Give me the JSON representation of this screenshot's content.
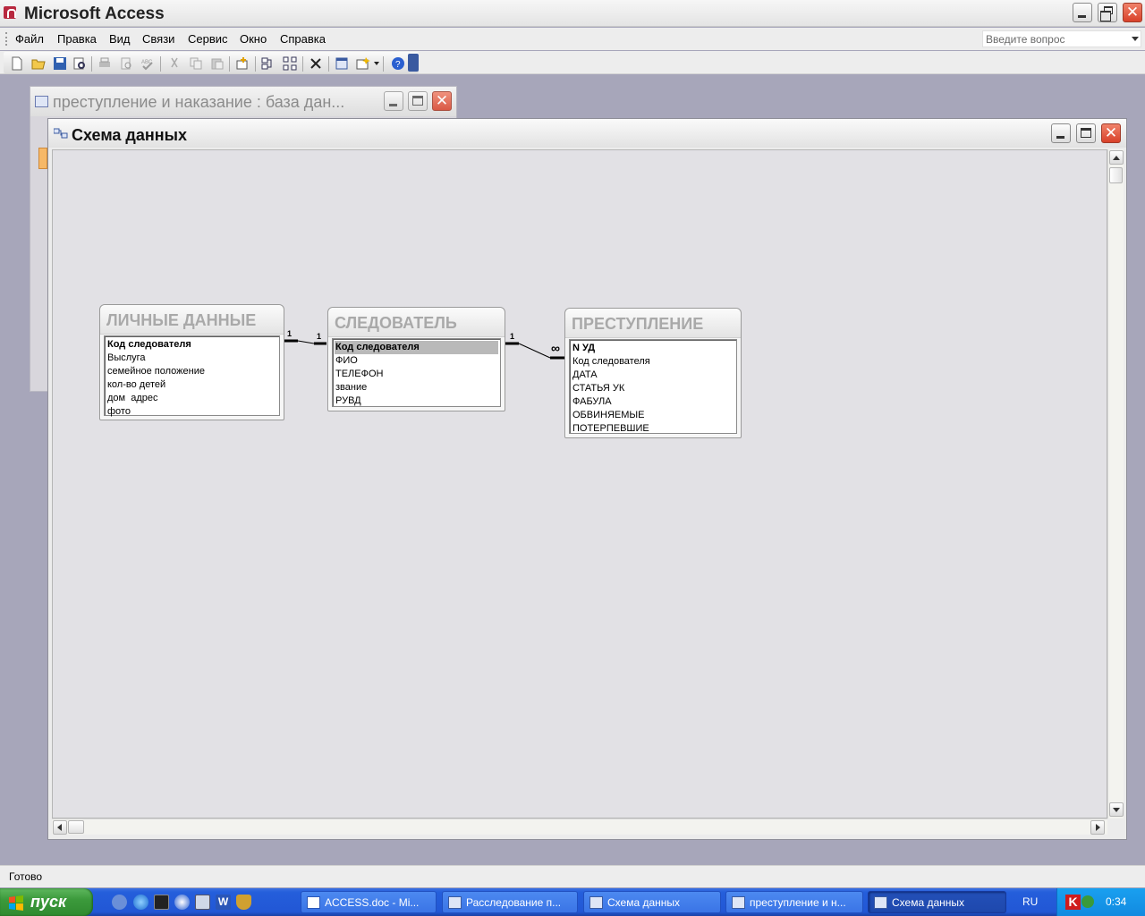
{
  "app": {
    "title": "Microsoft Access"
  },
  "menu": {
    "items": [
      "Файл",
      "Правка",
      "Вид",
      "Связи",
      "Сервис",
      "Окно",
      "Справка"
    ],
    "help_placeholder": "Введите вопрос"
  },
  "db_window": {
    "title": "преступление и наказание : база дан..."
  },
  "schema_window": {
    "title": "Схема данных"
  },
  "tables": [
    {
      "name": "ЛИЧНЫЕ ДАННЫЕ",
      "fields": [
        "Код следователя",
        "Выслуга",
        "семейное положение",
        "кол-во детей",
        "дом  адрес",
        "фото"
      ]
    },
    {
      "name": "СЛЕДОВАТЕЛЬ",
      "fields": [
        "Код следователя",
        "ФИО",
        "ТЕЛЕФОН",
        "звание",
        "РУВД"
      ]
    },
    {
      "name": "ПРЕСТУПЛЕНИЕ",
      "fields": [
        "N УД",
        "Код следователя",
        "ДАТА",
        "СТАТЬЯ УК",
        "ФАБУЛА",
        "ОБВИНЯЕМЫЕ",
        "ПОТЕРПЕВШИЕ"
      ]
    }
  ],
  "relations": [
    {
      "left_label": "1",
      "right_label": "1"
    },
    {
      "left_label": "1",
      "right_label": "∞"
    }
  ],
  "status": {
    "text": "Готово"
  },
  "taskbar": {
    "start_label": "пуск",
    "tasks": [
      "ACCESS.doc - Mi...",
      "Расследование п...",
      "Схема данных",
      "преступление и н...",
      "Схема данных"
    ],
    "language": "RU",
    "clock": "0:34"
  }
}
